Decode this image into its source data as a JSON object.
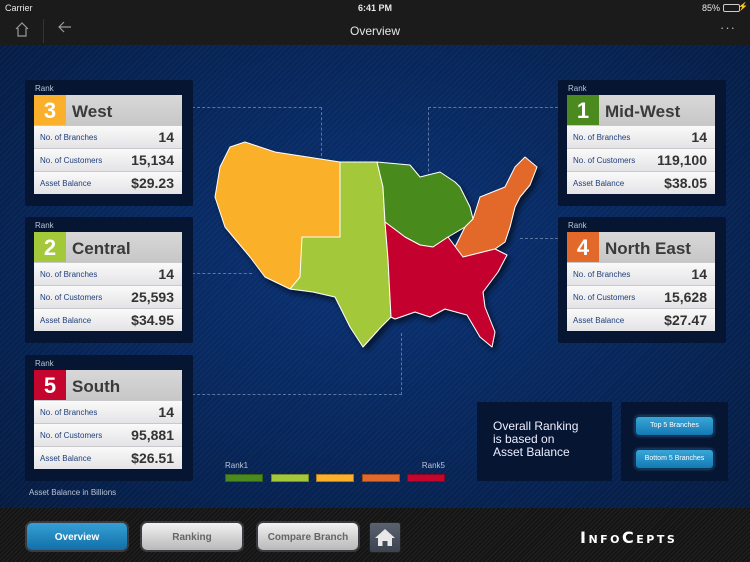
{
  "status_bar": {
    "carrier": "Carrier",
    "time": "6:41 PM",
    "battery": "85%",
    "battery_level": 0.85
  },
  "nav": {
    "title": "Overview"
  },
  "colors": {
    "rank1": "#4a8a1f",
    "rank2": "#a3c93a",
    "rank3": "#fbb02b",
    "rank4": "#e2692a",
    "rank5": "#c4062e"
  },
  "regions": [
    {
      "id": "west",
      "rank": "3",
      "rank_label": "Rank",
      "name": "West",
      "color": "#fbb02b",
      "rows": [
        {
          "label": "No. of Branches",
          "value": "14"
        },
        {
          "label": "No. of Customers",
          "value": "15,134"
        },
        {
          "label": "Asset Balance",
          "value": "$29.23"
        }
      ]
    },
    {
      "id": "central",
      "rank": "2",
      "rank_label": "Rank",
      "name": "Central",
      "color": "#a3c93a",
      "rows": [
        {
          "label": "No. of Branches",
          "value": "14"
        },
        {
          "label": "No. of Customers",
          "value": "25,593"
        },
        {
          "label": "Asset Balance",
          "value": "$34.95"
        }
      ]
    },
    {
      "id": "south",
      "rank": "5",
      "rank_label": "Rank",
      "name": "South",
      "color": "#c4062e",
      "rows": [
        {
          "label": "No. of Branches",
          "value": "14"
        },
        {
          "label": "No. of Customers",
          "value": "95,881"
        },
        {
          "label": "Asset Balance",
          "value": "$26.51"
        }
      ]
    },
    {
      "id": "midwest",
      "rank": "1",
      "rank_label": "Rank",
      "name": "Mid-West",
      "color": "#4a8a1f",
      "rows": [
        {
          "label": "No. of Branches",
          "value": "14"
        },
        {
          "label": "No. of Customers",
          "value": "119,100"
        },
        {
          "label": "Asset Balance",
          "value": "$38.05"
        }
      ]
    },
    {
      "id": "northeast",
      "rank": "4",
      "rank_label": "Rank",
      "name": "North East",
      "color": "#e2692a",
      "rows": [
        {
          "label": "No. of Branches",
          "value": "14"
        },
        {
          "label": "No. of Customers",
          "value": "15,628"
        },
        {
          "label": "Asset Balance",
          "value": "$27.47"
        }
      ]
    }
  ],
  "legend": {
    "start_label": "Rank1",
    "end_label": "Rank5",
    "swatches": [
      "#4a8a1f",
      "#a3c93a",
      "#fbb02b",
      "#e2692a",
      "#c4062e"
    ]
  },
  "footnote": "Asset Balance in Billions",
  "ranking_note": {
    "line1": "Overall Ranking",
    "line2": "is based on",
    "line3": "Asset Balance"
  },
  "branch_buttons": {
    "top": "Top 5 Branches",
    "bottom": "Bottom 5 Branches"
  },
  "bottom_tabs": [
    {
      "label": "Overview",
      "active": true
    },
    {
      "label": "Ranking",
      "active": false
    },
    {
      "label": "Compare Branch",
      "active": false
    }
  ],
  "logo": {
    "text_big1": "I",
    "text_small1": "NFO",
    "text_big2": "C",
    "text_small2": "EPTS"
  }
}
